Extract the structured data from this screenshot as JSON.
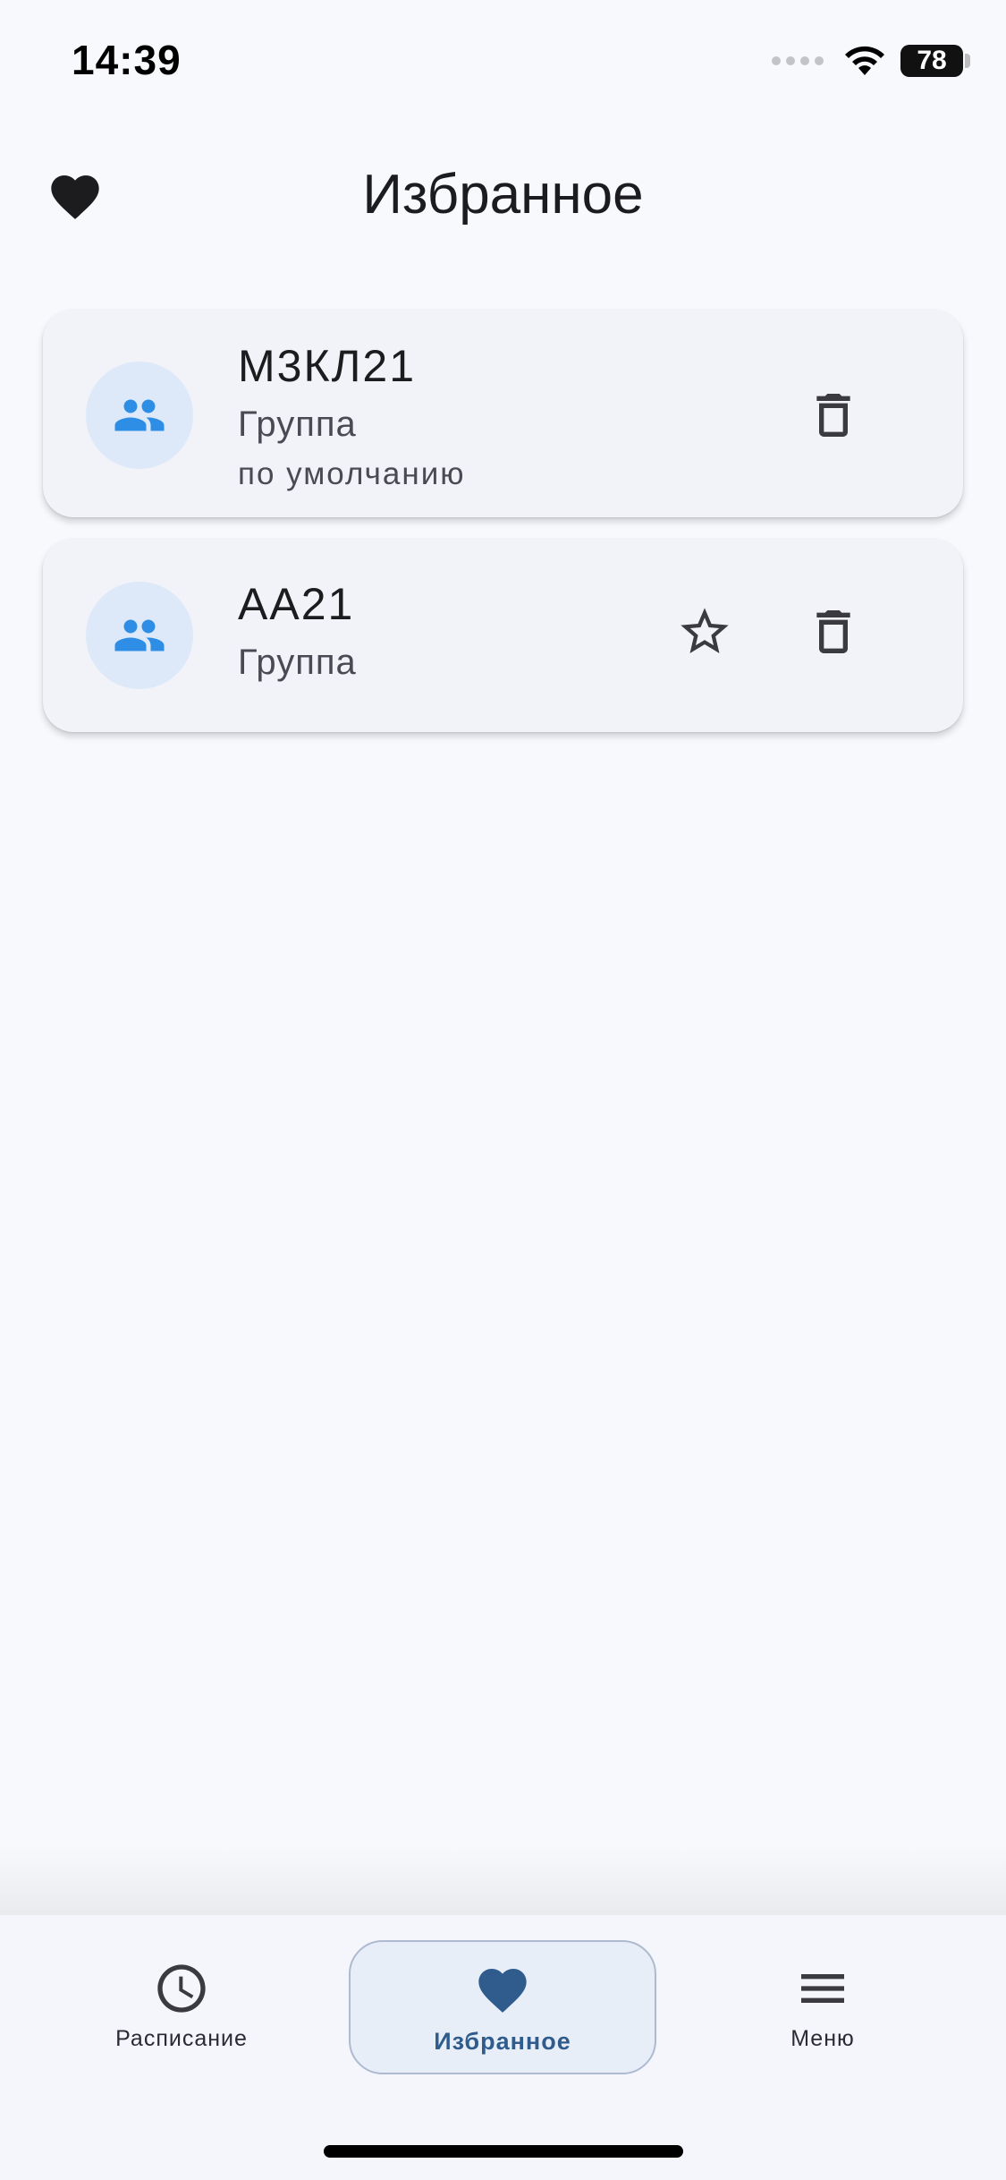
{
  "status_bar": {
    "time": "14:39",
    "battery": "78"
  },
  "header": {
    "title": "Избранное",
    "icon": "heart-icon"
  },
  "favorites": [
    {
      "title": "М3КЛ21",
      "subtitle": "Группа",
      "note": "по умолчанию",
      "icon": "people-icon",
      "actions": [
        "delete"
      ]
    },
    {
      "title": "АА21",
      "subtitle": "Группа",
      "icon": "people-icon",
      "actions": [
        "make-default",
        "delete"
      ]
    }
  ],
  "bottom_nav": {
    "items": [
      {
        "label": "Расписание",
        "icon": "clock-icon",
        "active": false
      },
      {
        "label": "Избранное",
        "icon": "heart-icon",
        "active": true
      },
      {
        "label": "Меню",
        "icon": "menu-icon",
        "active": false
      }
    ]
  },
  "colors": {
    "background": "#f7f9fd",
    "card": "#f1f3f8",
    "avatar_bg": "#dde9f9",
    "avatar_icon": "#2e8ee6",
    "nav_active": "#2f5b8d"
  }
}
